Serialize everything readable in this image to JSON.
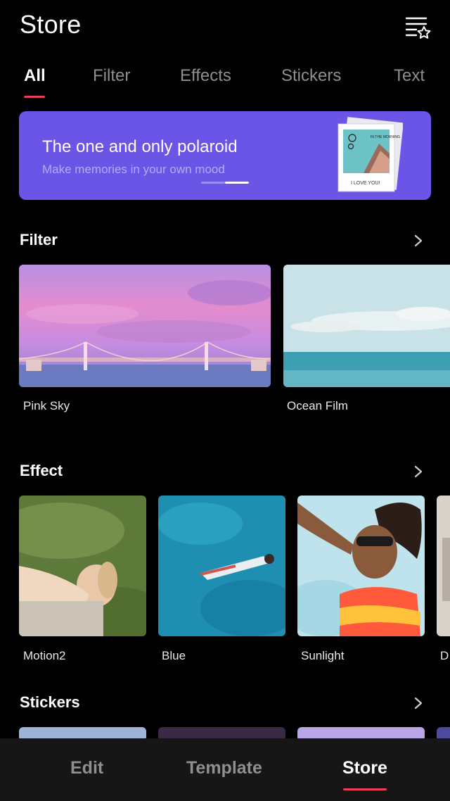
{
  "header": {
    "title": "Store",
    "filter_icon": "list-star-icon"
  },
  "tabs": [
    {
      "label": "All",
      "active": true
    },
    {
      "label": "Filter",
      "active": false
    },
    {
      "label": "Effects",
      "active": false
    },
    {
      "label": "Stickers",
      "active": false
    },
    {
      "label": "Text",
      "active": false
    }
  ],
  "banner": {
    "title": "The one and only polaroid",
    "subtitle": "Make memories in your own mood",
    "polaroid_caption": "I LOVE YOU!",
    "polaroid_note": "IN THE MORNING"
  },
  "sections": {
    "filter": {
      "title": "Filter",
      "items": [
        {
          "label": "Pink Sky"
        },
        {
          "label": "Ocean Film"
        }
      ]
    },
    "effect": {
      "title": "Effect",
      "items": [
        {
          "label": "Motion2"
        },
        {
          "label": "Blue"
        },
        {
          "label": "Sunlight"
        },
        {
          "label": "D"
        }
      ]
    },
    "stickers": {
      "title": "Stickers"
    }
  },
  "bottom_nav": [
    {
      "label": "Edit",
      "active": false
    },
    {
      "label": "Template",
      "active": false
    },
    {
      "label": "Store",
      "active": true
    }
  ],
  "colors": {
    "accent": "#ea3d5f",
    "banner": "#6a55e6",
    "background": "#000000",
    "nav_bg": "#161616"
  }
}
